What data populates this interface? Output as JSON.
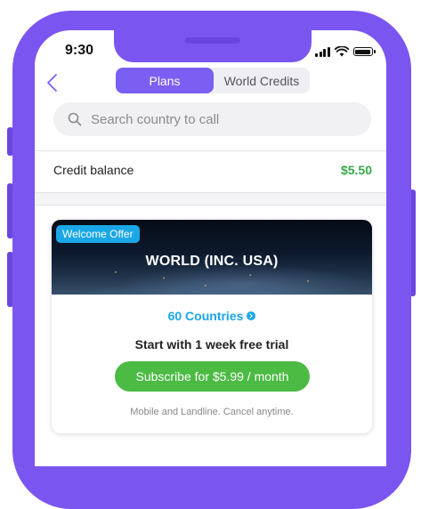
{
  "status_bar": {
    "time": "9:30"
  },
  "nav": {
    "tabs": [
      {
        "label": "Plans",
        "active": true
      },
      {
        "label": "World Credits",
        "active": false
      }
    ]
  },
  "search": {
    "placeholder": "Search country to call"
  },
  "credit": {
    "label": "Credit balance",
    "value": "$5.50"
  },
  "offer_card": {
    "badge": "Welcome Offer",
    "title": "WORLD (INC. USA)",
    "countries_link": "60 Countries",
    "trial_text": "Start with 1 week free trial",
    "subscribe_label": "Subscribe for $5.99 / month",
    "footnote": "Mobile and Landline. Cancel anytime."
  },
  "colors": {
    "accent": "#7b5ff2",
    "link": "#1aa7e6",
    "positive": "#34a845",
    "button": "#4cbb44",
    "frame": "#7b55f0"
  },
  "icons": [
    "signal-icon",
    "wifi-icon",
    "battery-icon",
    "back-chevron-icon",
    "search-icon",
    "chevron-right-circle-icon"
  ]
}
